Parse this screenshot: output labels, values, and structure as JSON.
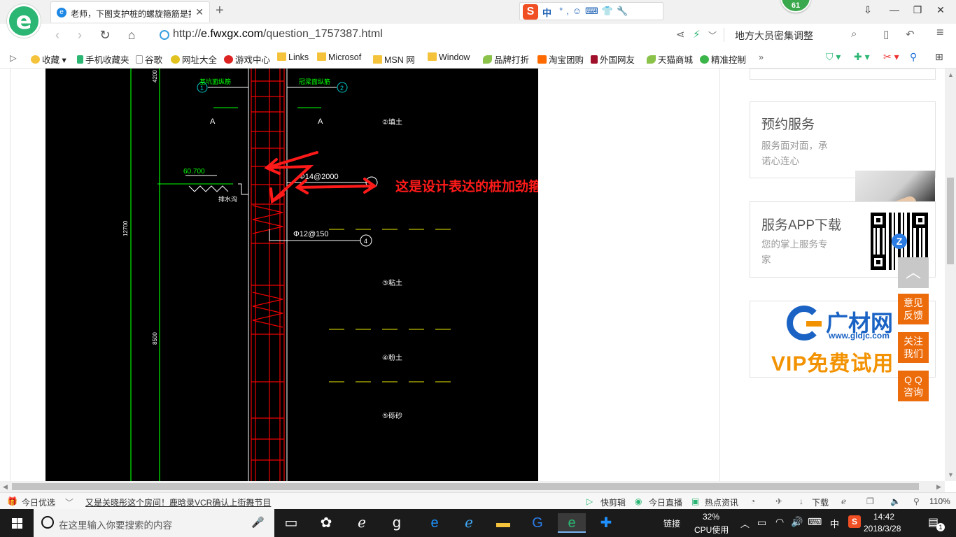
{
  "tab": {
    "title": "老师，下图支护桩的螺旋箍筋是按",
    "close": "✕",
    "new": "+"
  },
  "sogou": {
    "logo": "S",
    "lang": "中",
    "icons": "°,☺⌨👕🔧"
  },
  "badge": {
    "count": "61"
  },
  "window": {
    "min": "—",
    "max": "❐",
    "close": "✕",
    "pin": "⇩"
  },
  "address": {
    "prefix": "http://",
    "host": "e.fwxgx.com",
    "path": "/question_1757387.html",
    "search_text": "地方大员密集调整"
  },
  "bookmarks": [
    {
      "label": "收藏",
      "icon": "star-icon"
    },
    {
      "label": "手机收藏夹",
      "icon": "phone-icon"
    },
    {
      "label": "谷歌",
      "icon": "page-icon"
    },
    {
      "label": "网址大全",
      "icon": "globe-icon"
    },
    {
      "label": "游戏中心",
      "icon": "game-icon"
    },
    {
      "label": "Links",
      "icon": "folder-icon"
    },
    {
      "label": "Microsof",
      "icon": "folder-icon"
    },
    {
      "label": "MSN 网",
      "icon": "folder-icon"
    },
    {
      "label": "Window",
      "icon": "folder-icon"
    },
    {
      "label": "品牌打折",
      "icon": "leaf-icon"
    },
    {
      "label": "淘宝团购",
      "icon": "taobao-icon"
    },
    {
      "label": "外国网友",
      "icon": "flag-icon"
    },
    {
      "label": "天猫商城",
      "icon": "leaf-icon"
    },
    {
      "label": "精准控制",
      "icon": "chat-icon"
    }
  ],
  "cad": {
    "annotation": "这是设计表达的桩加劲箍",
    "elev": "60.700",
    "drain": "排水沟",
    "stirrup1": "Φ14@2000",
    "stirrup2": "Φ12@150",
    "dims": [
      "4200",
      "12700",
      "8500"
    ],
    "grid_a1": "A",
    "grid_a2": "A",
    "top_left": "基坑面纵筋",
    "top_right": "冠梁面纵筋",
    "c1": "1",
    "c2": "2",
    "c3": "3",
    "c4": "4",
    "soil1": "②填土",
    "soil2": "③粘土",
    "soil3": "④粉土",
    "soil4": "⑤砾砂"
  },
  "sidebar": {
    "service_title": "预约服务",
    "service_desc": [
      "服务面对面，承",
      "诺心连心"
    ],
    "app_title": "服务APP下载",
    "app_desc": [
      "您的掌上服务专",
      "家"
    ],
    "ad_brand": "广材网",
    "ad_url": "www.gldjc.com",
    "ad_vip": "VIP免费试用"
  },
  "float": {
    "top": "︿",
    "feedback": [
      "意见",
      "反馈"
    ],
    "follow": [
      "关注",
      "我们"
    ],
    "qq": [
      "Q Q",
      "咨询"
    ]
  },
  "status": {
    "pick": "今日优选",
    "news": "又是关晓彤这个房间！鹿晗录VCR确认上街舞节目",
    "kuaijian": "快剪辑",
    "live": "今日直播",
    "hot": "热点资讯",
    "download": "下载",
    "zoom": "110%"
  },
  "taskbar": {
    "search_placeholder": "在这里输入你要搜索的内容",
    "link": "链接",
    "cpu_pct": "32%",
    "cpu_label": "CPU使用",
    "ime": "中",
    "time": "14:42",
    "date": "2018/3/28",
    "notif": "1"
  }
}
